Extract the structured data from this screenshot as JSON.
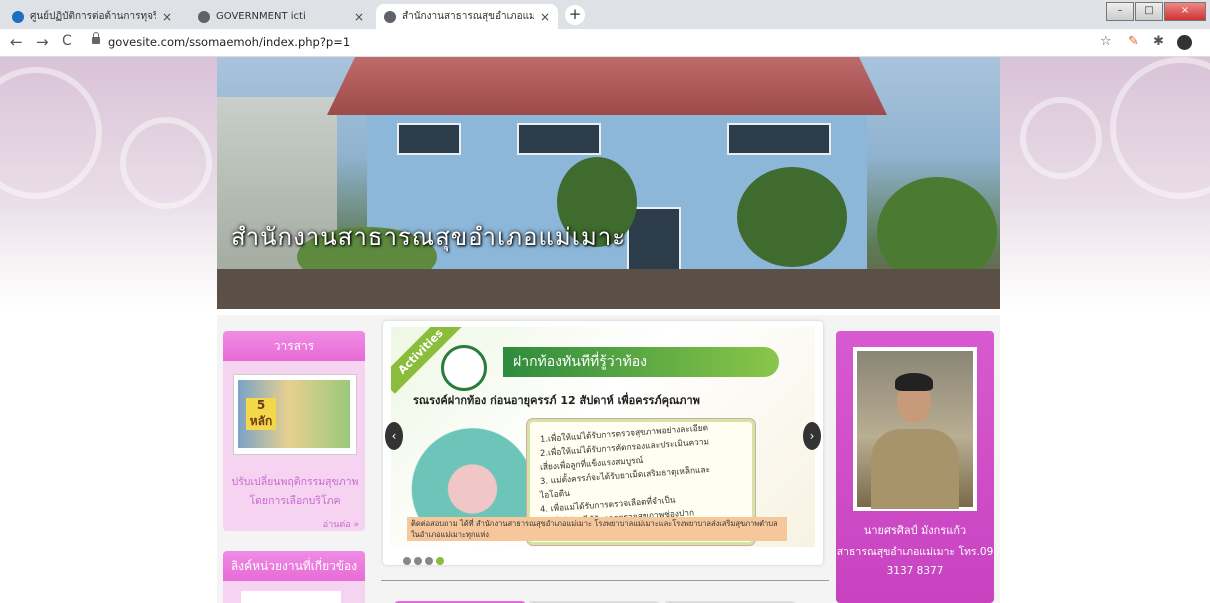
{
  "browser": {
    "tabs": [
      {
        "title": "ศูนย์ปฏิบัติการต่อต้านการทุจริต กระทร",
        "favicon_color": "#1b6ec2",
        "active": false
      },
      {
        "title": "GOVERNMENT icti",
        "favicon_color": "#5f6368",
        "active": false
      },
      {
        "title": "สำนักงานสาธารณสุขอำเภอแม่เมาะ wx",
        "favicon_color": "#5f6368",
        "active": true
      }
    ],
    "new_tab_label": "+",
    "url": "govesite.com/ssomaemoh/index.php?p=1",
    "nav": {
      "back": "←",
      "forward": "→",
      "reload": "C"
    },
    "star": "☆",
    "extensions": [
      "extension-pin-icon",
      "puzzle-icon",
      "profile-avatar-icon"
    ]
  },
  "banner": {
    "title": "สำนักงานสาธารณสุขอำเภอแม่เมาะ"
  },
  "journal": {
    "header": "วารสาร",
    "thumb_text": "5 หลัก",
    "caption": "ปรับเปลี่ยนพฤติกรรมสุขภาพโดยการเลือกบริโภค",
    "more": "อ่านต่อ »"
  },
  "links": {
    "header": "ลิงค์หน่วยงานที่เกี่ยวข้อง"
  },
  "slider": {
    "ribbon": "Activities",
    "headline": "ฝากท้องทันทีที่รู้ว่าท้อง",
    "subtitle": "รณรงค์ฝากท้อง ก่อนอายุครรภ์ 12 สัปดาห์ เพื่อครรภ์คุณภาพ",
    "points": [
      "1.เพื่อให้แม่ได้รับการตรวจสุขภาพอย่างละเอียด",
      "2.เพื่อให้แม่ได้รับการคัดกรองและประเมินความ",
      "เสี่ยงเพื่อลูกที่แข็งแรงสมบูรณ์",
      "3. แม่ตั้งครรภ์จะได้รับยาเม็ดเสริมธาตุเหล็กและ",
      "ไอโอดีน",
      "4. เพื่อแม่ได้รับการตรวจเลือดที่จำเป็น",
      "5. เพื่อให้แม่ได้รับการตรวจสุขภาพช่องปาก"
    ],
    "contact": "ติดต่อสอบถาม ได้ที่ สำนักงานสาธารณสุขอำเภอแม่เมาะ โรงพยาบาลแม่เมาะและโรงพยาบาลส่งเสริมสุขภาพตำบลในอำเภอแม่เมาะทุกแห่ง",
    "prev": "‹",
    "next": "›",
    "dot_count": 4,
    "active_dot": 3
  },
  "profile": {
    "name": "นายศรศิลป์ มังกรแก้ว",
    "role": "สาธารณสุขอำเภอแม่เมาะ โทร.09",
    "phone": "3137 8377"
  },
  "colors": {
    "accent_pink": "#e76bd6",
    "profile_purple": "#c842c0",
    "link_text": "#c86ad0",
    "slide_green": "#8abd3b"
  }
}
